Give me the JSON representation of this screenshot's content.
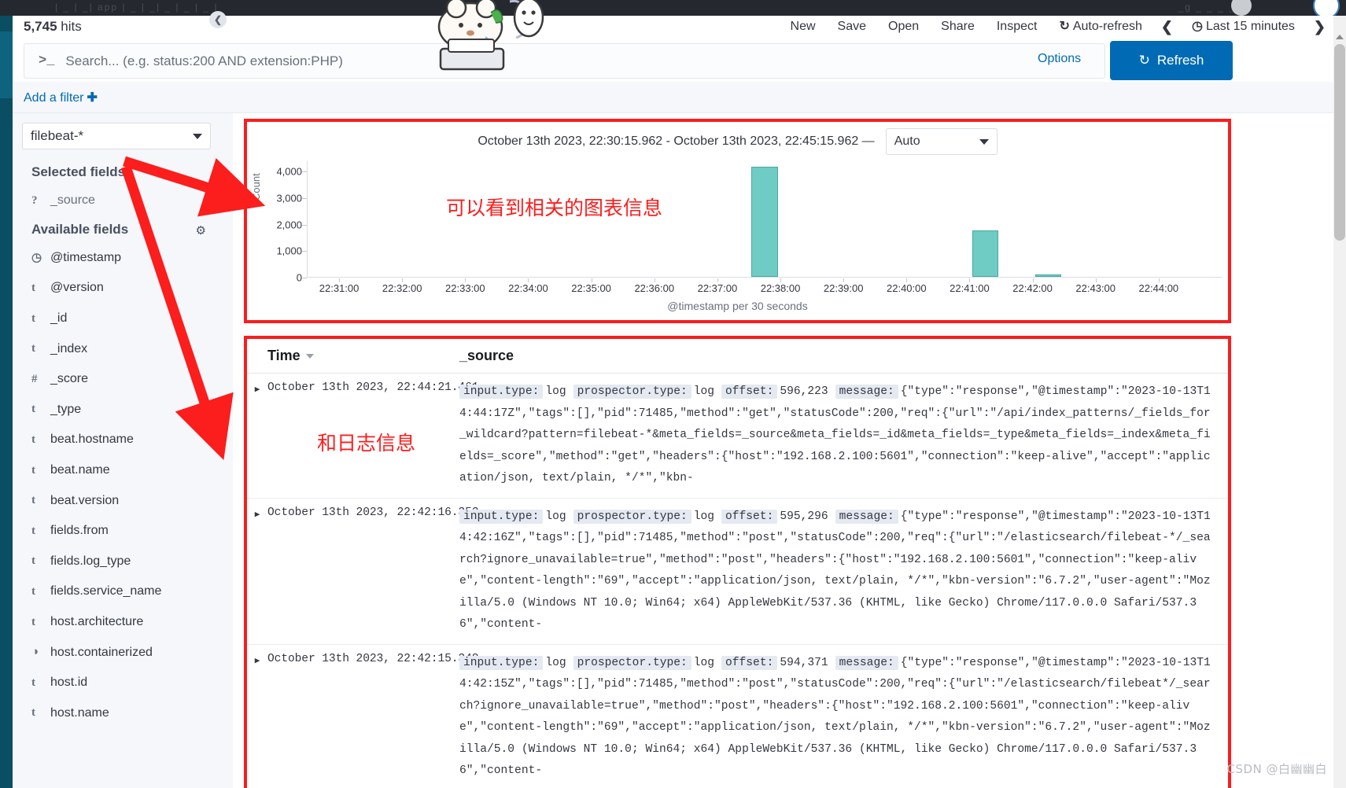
{
  "browser": {
    "ghost_tabs_left": "|  _  |   _|  app    |  _  |  _|  _  | _ |  _  |",
    "ghost_tabs_right": "_g  _  _  _   _"
  },
  "header": {
    "hits_count": "5,745",
    "hits_label": "hits",
    "nav_items": [
      {
        "label": "New",
        "icon": ""
      },
      {
        "label": "Save",
        "icon": ""
      },
      {
        "label": "Open",
        "icon": ""
      },
      {
        "label": "Share",
        "icon": ""
      },
      {
        "label": "Inspect",
        "icon": ""
      },
      {
        "label": "Auto-refresh",
        "icon": "refresh-icon"
      }
    ],
    "prev_chevron": "❮",
    "next_chevron": "❯",
    "time_picker": {
      "icon": "clock-icon",
      "label": "Last 15 minutes"
    }
  },
  "query": {
    "prompt_glyph": ">_",
    "placeholder": "Search... (e.g. status:200 AND extension:PHP)",
    "value": "",
    "options_label": "Options",
    "refresh_label": "Refresh",
    "refresh_icon": "refresh-icon"
  },
  "filters": {
    "add_filter_label": "Add a filter",
    "plus": "✚"
  },
  "sidebar": {
    "index_pattern": "filebeat-*",
    "collapse_icon": "chevron-left-icon",
    "selected_fields_title": "Selected fields",
    "selected_fields": [
      {
        "type": "?",
        "name": "_source"
      }
    ],
    "available_fields_title": "Available fields",
    "settings_icon": "gear-icon",
    "available_fields": [
      {
        "type": "◷",
        "name": "@timestamp"
      },
      {
        "type": "t",
        "name": "@version"
      },
      {
        "type": "t",
        "name": "_id"
      },
      {
        "type": "t",
        "name": "_index"
      },
      {
        "type": "#",
        "name": "_score"
      },
      {
        "type": "t",
        "name": "_type"
      },
      {
        "type": "t",
        "name": "beat.hostname"
      },
      {
        "type": "t",
        "name": "beat.name"
      },
      {
        "type": "t",
        "name": "beat.version"
      },
      {
        "type": "t",
        "name": "fields.from"
      },
      {
        "type": "t",
        "name": "fields.log_type"
      },
      {
        "type": "t",
        "name": "fields.service_name"
      },
      {
        "type": "t",
        "name": "host.architecture"
      },
      {
        "type": "◑",
        "name": "host.containerized"
      },
      {
        "type": "t",
        "name": "host.id"
      },
      {
        "type": "t",
        "name": "host.name"
      }
    ]
  },
  "chart_panel": {
    "range_text": "October 13th 2023, 22:30:15.962 - October 13th 2023, 22:45:15.962 —",
    "interval_value": "Auto",
    "annotation_cn": "可以看到相关的图表信息"
  },
  "chart_data": {
    "type": "bar",
    "title": "",
    "xlabel": "@timestamp per 30 seconds",
    "ylabel": "Count",
    "ylim": [
      0,
      4400
    ],
    "yticks": [
      0,
      1000,
      2000,
      3000,
      4000
    ],
    "ytick_labels": [
      "0",
      "1,000",
      "2,000",
      "3,000",
      "4,000"
    ],
    "xtick_labels": [
      "22:31:00",
      "22:32:00",
      "22:33:00",
      "22:34:00",
      "22:35:00",
      "22:36:00",
      "22:37:00",
      "22:38:00",
      "22:39:00",
      "22:40:00",
      "22:41:00",
      "22:42:00",
      "22:43:00",
      "22:44:00"
    ],
    "grid": false,
    "legend": "none",
    "bar_color": "#6eccc4",
    "categories": [
      "22:30:30",
      "22:31:00",
      "22:31:30",
      "22:32:00",
      "22:32:30",
      "22:33:00",
      "22:33:30",
      "22:34:00",
      "22:34:30",
      "22:35:00",
      "22:35:30",
      "22:36:00",
      "22:36:30",
      "22:37:00",
      "22:37:30",
      "22:38:00",
      "22:38:30",
      "22:39:00",
      "22:39:30",
      "22:40:00",
      "22:40:30",
      "22:41:00",
      "22:41:30",
      "22:42:00",
      "22:42:30",
      "22:43:00",
      "22:43:30",
      "22:44:00",
      "22:44:30"
    ],
    "values": [
      0,
      0,
      0,
      0,
      0,
      0,
      0,
      0,
      0,
      0,
      0,
      0,
      0,
      0,
      4150,
      0,
      0,
      0,
      0,
      0,
      0,
      1750,
      0,
      90,
      0,
      0,
      0,
      0,
      0
    ]
  },
  "docs_table": {
    "annotation_cn": "和日志信息",
    "columns": [
      "Time",
      "_source"
    ],
    "rows": [
      {
        "time": "October 13th 2023, 22:44:21.461",
        "fields": [
          {
            "key": "input.type:",
            "value": "log"
          },
          {
            "key": "prospector.type:",
            "value": "log"
          },
          {
            "key": "offset:",
            "value": "596,223"
          },
          {
            "key": "message:",
            "value": "{\"type\":\"response\",\"@timestamp\":\"2023-10-13T14:44:17Z\",\"tags\":[],\"pid\":71485,\"method\":\"get\",\"statusCode\":200,\"req\":{\"url\":\"/api/index_patterns/_fields_for_wildcard?pattern=filebeat-*&meta_fields=_source&meta_fields=_id&meta_fields=_type&meta_fields=_index&meta_fields=_score\",\"method\":\"get\",\"headers\":{\"host\":\"192.168.2.100:5601\",\"connection\":\"keep-alive\",\"accept\":\"application/json, text/plain, */*\",\"kbn-"
          }
        ]
      },
      {
        "time": "October 13th 2023, 22:42:16.353",
        "fields": [
          {
            "key": "input.type:",
            "value": "log"
          },
          {
            "key": "prospector.type:",
            "value": "log"
          },
          {
            "key": "offset:",
            "value": "595,296"
          },
          {
            "key": "message:",
            "value": "{\"type\":\"response\",\"@timestamp\":\"2023-10-13T14:42:16Z\",\"tags\":[],\"pid\":71485,\"method\":\"post\",\"statusCode\":200,\"req\":{\"url\":\"/elasticsearch/filebeat-*/_search?ignore_unavailable=true\",\"method\":\"post\",\"headers\":{\"host\":\"192.168.2.100:5601\",\"connection\":\"keep-alive\",\"content-length\":\"69\",\"accept\":\"application/json, text/plain, */*\",\"kbn-version\":\"6.7.2\",\"user-agent\":\"Mozilla/5.0 (Windows NT 10.0; Win64; x64) AppleWebKit/537.36 (KHTML, like Gecko) Chrome/117.0.0.0 Safari/537.36\",\"content-"
          }
        ]
      },
      {
        "time": "October 13th 2023, 22:42:15.348",
        "fields": [
          {
            "key": "input.type:",
            "value": "log"
          },
          {
            "key": "prospector.type:",
            "value": "log"
          },
          {
            "key": "offset:",
            "value": "594,371"
          },
          {
            "key": "message:",
            "value": "{\"type\":\"response\",\"@timestamp\":\"2023-10-13T14:42:15Z\",\"tags\":[],\"pid\":71485,\"method\":\"post\",\"statusCode\":200,\"req\":{\"url\":\"/elasticsearch/filebeat*/_search?ignore_unavailable=true\",\"method\":\"post\",\"headers\":{\"host\":\"192.168.2.100:5601\",\"connection\":\"keep-alive\",\"content-length\":\"69\",\"accept\":\"application/json, text/plain, */*\",\"kbn-version\":\"6.7.2\",\"user-agent\":\"Mozilla/5.0 (Windows NT 10.0; Win64; x64) AppleWebKit/537.36 (KHTML, like Gecko) Chrome/117.0.0.0 Safari/537.36\",\"content-"
          }
        ]
      }
    ]
  },
  "watermark": "CSDN @白幽幽白"
}
